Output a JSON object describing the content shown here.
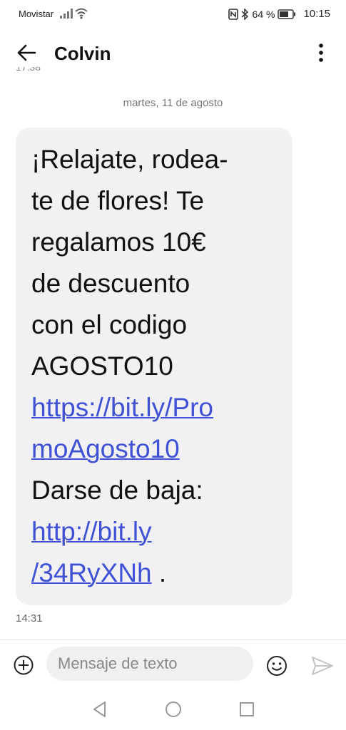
{
  "status_bar": {
    "carrier": "Movistar",
    "battery": "64 %",
    "time": "10:15"
  },
  "header": {
    "contact_name": "Colvin",
    "clipped_time": "17:38"
  },
  "conversation": {
    "date_separator": "martes, 11 de agosto",
    "message": {
      "lines": [
        "¡Relajate, rodea-",
        "te de flores! Te",
        "regalamos 10€",
        "de descuento",
        "con el codigo",
        "AGOSTO10"
      ],
      "link1_lines": [
        "https://bit.ly/Pro",
        "moAgosto10"
      ],
      "unsubscribe_label": "Darse de baja:",
      "link2_lines": [
        "http://bit.ly",
        "/34RyXNh"
      ],
      "trailing_text": " .",
      "time": "14:31"
    }
  },
  "input_bar": {
    "placeholder": "Mensaje de texto"
  },
  "colors": {
    "bubble": "#f1f1f3",
    "link": "#3f51d4",
    "input_bg": "#f0f0f2"
  }
}
